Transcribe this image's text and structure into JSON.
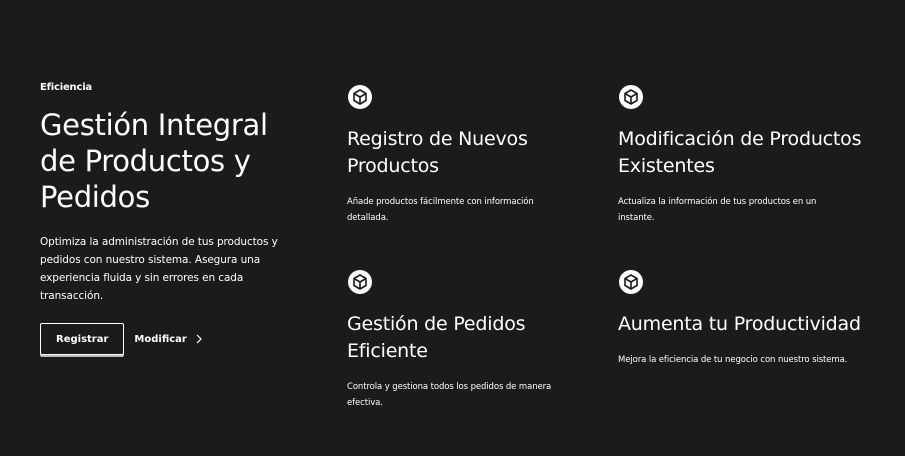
{
  "hero": {
    "eyebrow": "Eficiencia",
    "title": "Gestión Integral de Productos y Pedidos",
    "description": "Optimiza la administración de tus productos y pedidos con nuestro sistema. Asegura una experiencia fluida y sin errores en cada transacción.",
    "primary_button": "Registrar",
    "secondary_link": "Modificar"
  },
  "features": [
    {
      "icon": "cube-icon",
      "title": "Registro de Nuevos Productos",
      "description": "Añade productos fácilmente con información detallada."
    },
    {
      "icon": "cube-icon",
      "title": "Modificación de Productos Existentes",
      "description": "Actualiza la información de tus productos en un instante."
    },
    {
      "icon": "cube-icon",
      "title": "Gestión de Pedidos Eficiente",
      "description": "Controla y gestiona todos los pedidos de manera efectiva."
    },
    {
      "icon": "cube-icon",
      "title": "Aumenta tu Productividad",
      "description": "Mejora la eficiencia de tu negocio con nuestro sistema."
    }
  ],
  "colors": {
    "background": "#1c1b1b",
    "text": "#ffffff"
  }
}
